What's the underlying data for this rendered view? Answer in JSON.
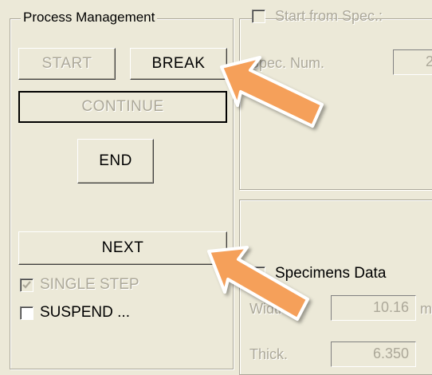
{
  "process_management": {
    "title": "Process Management",
    "start_label": "START",
    "break_label": "BREAK",
    "continue_label": "CONTINUE",
    "end_label": "END",
    "next_label": "NEXT",
    "single_step_label": "SINGLE STEP",
    "single_step_checked": true,
    "suspend_label": "SUSPEND ..."
  },
  "start_from_spec": {
    "label": "Start from Spec.:",
    "spec_num_label": "Spec. Num.",
    "spec_num_value": "2"
  },
  "specimens": {
    "label": "Specimens Data",
    "width_label": "Width",
    "width_value": "10.16",
    "width_unit": "m",
    "thick_label": "Thick.",
    "thick_value": "6.350"
  },
  "colors": {
    "window_bg": "#ece9d8",
    "arrow_fill": "#f5a05a",
    "arrow_outline": "#ffffff"
  },
  "icons": [
    "checkmark-icon",
    "callout-arrow"
  ]
}
